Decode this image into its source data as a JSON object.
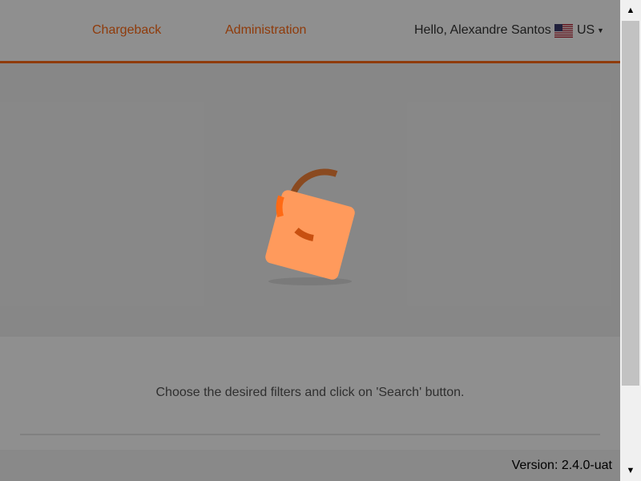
{
  "nav": {
    "chargeback_label": "Chargeback",
    "administration_label": "Administration"
  },
  "user": {
    "greeting": "Hello, Alexandre Santos",
    "locale_label": "US",
    "flag_icon": "us-flag-icon",
    "caret_icon": "caret-down-icon"
  },
  "main": {
    "message": "Choose the desired filters and click on 'Search' button."
  },
  "footer": {
    "version_label": "Version: 2.4.0-uat"
  },
  "loader": {
    "icon": "loading-spinner-icon"
  },
  "scrollbar": {
    "up_icon": "scroll-up-arrow-icon",
    "down_icon": "scroll-down-arrow-icon"
  },
  "colors": {
    "accent": "#ff6a14",
    "overlay": "#8a8a8a",
    "text": "#333333"
  }
}
